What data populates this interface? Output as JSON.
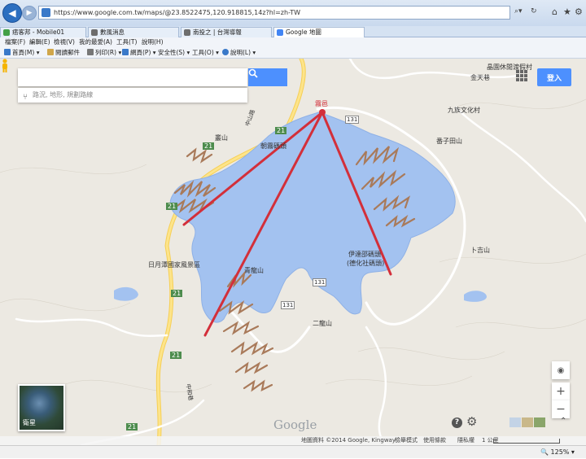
{
  "browser": {
    "url": "https://www.google.com.tw/maps/@23.8522475,120.918815,14z?hl=zh-TW",
    "tabs": [
      {
        "label": "痞客邦 - Mobile01",
        "color": "#43a047"
      },
      {
        "label": "數風消息",
        "color": "#6d6d6d"
      },
      {
        "label": "南投之 | 台灣導報",
        "color": "#6d6d6d"
      },
      {
        "label": "Google 地圖",
        "color": "#4285f4",
        "active": true
      }
    ],
    "menus": [
      "檔案(F)",
      "編輯(E)",
      "檢視(V)",
      "我的最愛(A)",
      "工具(T)",
      "說明(H)"
    ],
    "favorites": [
      {
        "label": "首頁(M)",
        "color": "#3a79c9"
      },
      {
        "label": "閱讀郵件",
        "color": "#d0a64a"
      },
      {
        "label": "列印(R)",
        "color": "#777777"
      },
      {
        "label": "網頁(P)",
        "color": "#3a79c9"
      },
      {
        "label": "安全性(S)",
        "color": "#777777"
      },
      {
        "label": "工具(O)",
        "color": "#777777"
      },
      {
        "label": "說明(L)",
        "color": "#3a79c9"
      }
    ],
    "zoom": "125%"
  },
  "map": {
    "search_placeholder": "",
    "route_placeholder": "路況, 地形, 規劃路線",
    "signin_label": "登入",
    "satellite_label": "衛星",
    "logo": "Google",
    "labels": {
      "lodge": "晶園休閒渡假村",
      "jintian": "金天巷",
      "jiuzu": "九族文化村",
      "fanzi": "番子田山",
      "hanlin": "霧邑",
      "shanshan": "叢山",
      "chaowu": "朝霧碼頭",
      "sunmoon": "日月潭國家風景區",
      "qinglong": "青龍山",
      "ita": "伊達邵碼頭",
      "ita2": "(德化社碼頭)",
      "erlong": "二龍山",
      "buji": "卜吉山",
      "r21a": "21",
      "r21b": "21",
      "r21c": "21",
      "r21d": "21",
      "r21e": "21",
      "r21f": "21",
      "r131": "131",
      "r131b": "131",
      "r131c": "131",
      "pinghe": "中和巷",
      "xiangshan": "中山路"
    },
    "footer": {
      "data": "地圖資料 ©2014 Google, Kingway",
      "report": "檢舉模式",
      "terms": "使用條款",
      "privacy": "隱私權",
      "scale": "1 公里"
    },
    "colors": {
      "water": "#a3c2f0",
      "lines": "#d32f3a",
      "sketch": "#a97a5a",
      "road": "#fde48a"
    }
  }
}
